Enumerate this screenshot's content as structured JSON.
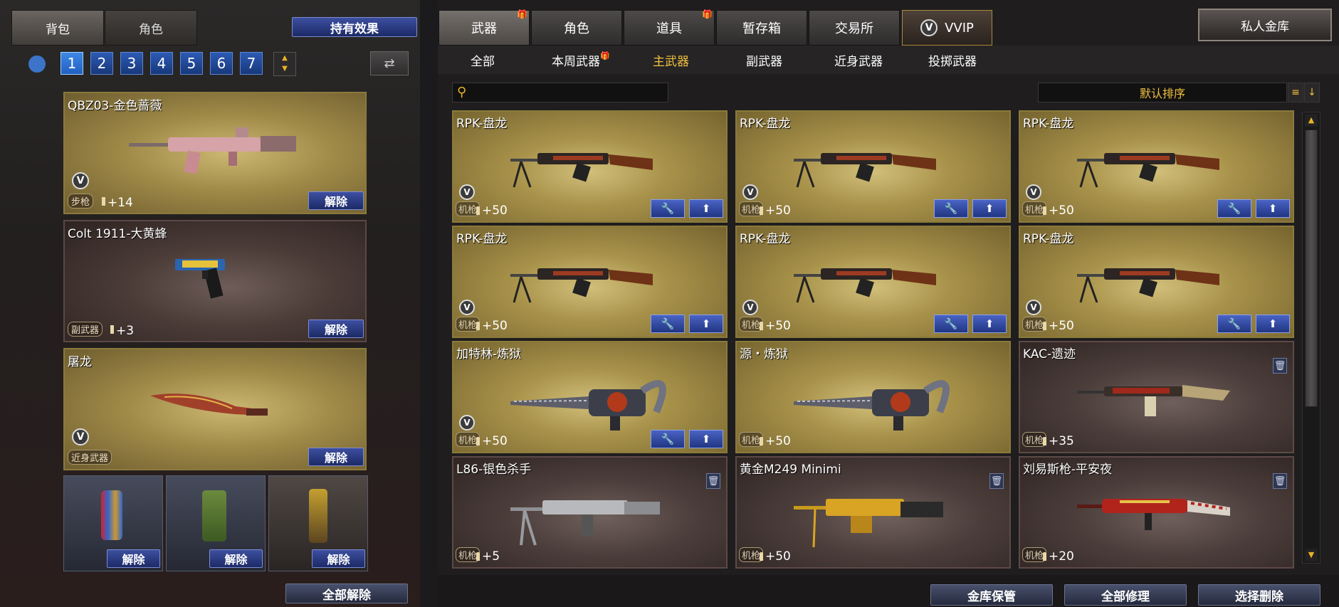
{
  "left": {
    "tabs": [
      {
        "label": "背包"
      },
      {
        "label": "角色"
      }
    ],
    "effects_button": "持有效果",
    "pages": [
      "1",
      "2",
      "3",
      "4",
      "5",
      "6",
      "7"
    ],
    "selected_page": "1",
    "slots": [
      {
        "name": "QBZ03-金色蔷薇",
        "type": "步枪",
        "plus": "+14",
        "action": "解除"
      },
      {
        "name": "Colt 1911-大黄蜂",
        "type": "副武器",
        "plus": "+3",
        "action": "解除"
      },
      {
        "name": "屠龙",
        "type": "近身武器",
        "plus": "",
        "action": "解除"
      }
    ],
    "grenades": [
      {
        "action": "解除"
      },
      {
        "action": "解除"
      },
      {
        "action": "解除"
      }
    ],
    "unequip_all": "全部解除"
  },
  "right": {
    "tabs": [
      {
        "label": "武器",
        "gift": true
      },
      {
        "label": "角色",
        "gift": false
      },
      {
        "label": "道具",
        "gift": true
      },
      {
        "label": "暂存箱",
        "gift": false
      },
      {
        "label": "交易所",
        "gift": false
      },
      {
        "label": "VVIP",
        "gift": false
      }
    ],
    "vault_button": "私人金库",
    "subtabs": [
      {
        "label": "全部",
        "gift": false
      },
      {
        "label": "本周武器",
        "gift": true
      },
      {
        "label": "主武器",
        "gift": false
      },
      {
        "label": "副武器",
        "gift": false
      },
      {
        "label": "近身武器",
        "gift": false
      },
      {
        "label": "投掷武器",
        "gift": false
      }
    ],
    "selected_subtab": "主武器",
    "search": {
      "placeholder": "",
      "value": ""
    },
    "sort_label": "默认排序",
    "items": [
      {
        "name": "RPK-盘龙",
        "type": "机枪",
        "plus": "+50",
        "style": "gold",
        "vvip": true,
        "actions": true,
        "gun": "rpk"
      },
      {
        "name": "RPK-盘龙",
        "type": "机枪",
        "plus": "+50",
        "style": "gold",
        "vvip": true,
        "actions": true,
        "gun": "rpk"
      },
      {
        "name": "RPK-盘龙",
        "type": "机枪",
        "plus": "+50",
        "style": "gold",
        "vvip": true,
        "actions": true,
        "gun": "rpk"
      },
      {
        "name": "RPK-盘龙",
        "type": "机枪",
        "plus": "+50",
        "style": "gold",
        "vvip": true,
        "actions": true,
        "gun": "rpk"
      },
      {
        "name": "RPK-盘龙",
        "type": "机枪",
        "plus": "+50",
        "style": "gold",
        "vvip": true,
        "actions": true,
        "gun": "rpk"
      },
      {
        "name": "RPK-盘龙",
        "type": "机枪",
        "plus": "+50",
        "style": "gold",
        "vvip": true,
        "actions": true,
        "gun": "rpk"
      },
      {
        "name": "加特林-炼狱",
        "type": "机枪",
        "plus": "+50",
        "style": "gold",
        "vvip": true,
        "actions": true,
        "gun": "gatling"
      },
      {
        "name": "源・炼狱",
        "type": "机枪",
        "plus": "+50",
        "style": "gold",
        "vvip": false,
        "actions": false,
        "gun": "gatling"
      },
      {
        "name": "KAC-遗迹",
        "type": "机枪",
        "plus": "+35",
        "style": "dark",
        "vvip": false,
        "actions": false,
        "trash": true,
        "gun": "kac"
      },
      {
        "name": "L86-银色杀手",
        "type": "机枪",
        "plus": "+5",
        "style": "dark",
        "vvip": false,
        "actions": false,
        "trash": true,
        "gun": "l86"
      },
      {
        "name": "黄金M249 Minimi",
        "type": "机枪",
        "plus": "+50",
        "style": "dark",
        "vvip": false,
        "actions": false,
        "trash": true,
        "gun": "m249"
      },
      {
        "name": "刘易斯枪-平安夜",
        "type": "机枪",
        "plus": "+20",
        "style": "dark",
        "vvip": false,
        "actions": false,
        "trash": true,
        "gun": "lewis"
      }
    ],
    "bottom_buttons": [
      "金库保管",
      "全部修理",
      "选择删除"
    ]
  }
}
